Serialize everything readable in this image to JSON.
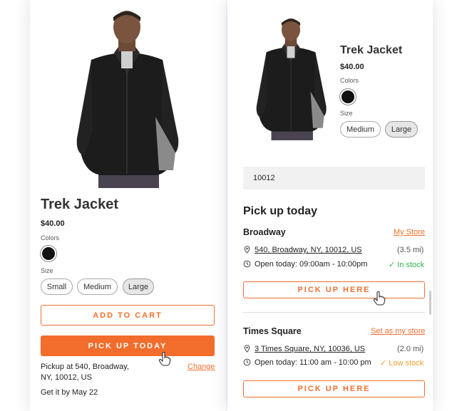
{
  "product": {
    "title": "Trek Jacket",
    "price": "$40.00",
    "colors_label": "Colors",
    "size_label": "Size",
    "sizes_left": [
      "Small",
      "Medium",
      "Large"
    ],
    "sizes_right": [
      "Medium",
      "Large"
    ],
    "selected_size": "Large",
    "color": "#111111"
  },
  "left": {
    "add_to_cart": "ADD TO CART",
    "pick_up_today": "PICK UP TODAY",
    "pickup_line1": "Pickup at 540, Broadway,",
    "pickup_line2": "NY, 10012, US",
    "change_link": "Change",
    "get_it_by": "Get it by May 22"
  },
  "right": {
    "zip_value": "10012",
    "section_title": "Pick up today",
    "stores": [
      {
        "name": "Broadway",
        "action_link": "My Store",
        "address": "540, Broadway, NY, 10012, US",
        "distance": "(3.5 mi)",
        "hours": "Open today: 09:00am - 10:00pm",
        "stock": "✓ In stock",
        "stock_color": "#2fb34a",
        "button": "PICK UP HERE"
      },
      {
        "name": "Times Square",
        "action_link": "Set as my store",
        "address": "3 Times Square, NY, 10036, US",
        "distance": "(2.0 mi)",
        "hours": "Open today: 11:00 am - 10:00 pm",
        "stock": "✓ Low stock",
        "stock_color": "#f0a030",
        "button": "PICK UP HERE"
      }
    ]
  },
  "colors": {
    "accent": "#f26c2b",
    "in_stock": "#2fb34a",
    "low_stock": "#f0a030"
  },
  "icons": [
    "location-pin-icon",
    "clock-icon",
    "hand-pointer-cursor-icon"
  ]
}
